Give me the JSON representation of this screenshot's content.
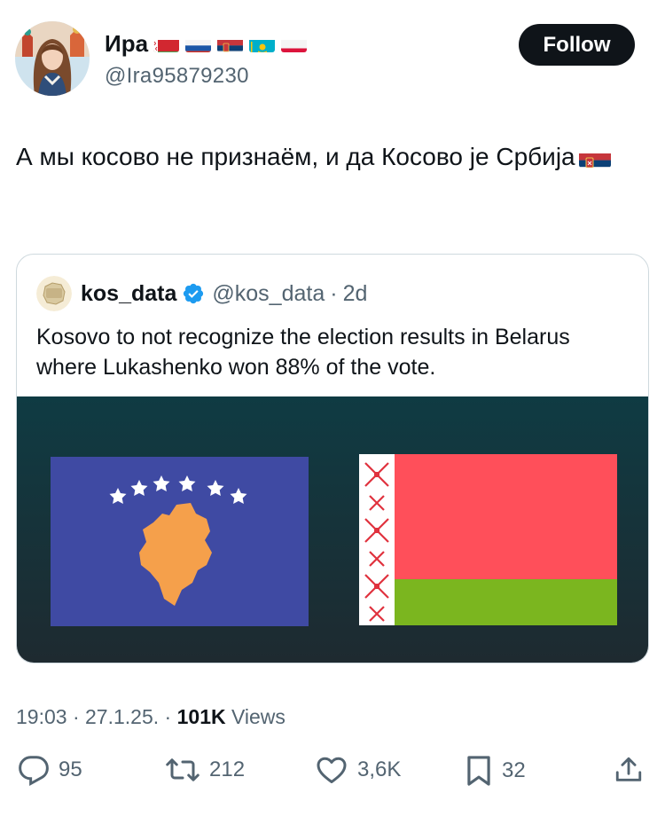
{
  "author": {
    "name": "Ира",
    "handle": "@Ira95879230",
    "flags": [
      "belarus-flag",
      "russia-flag",
      "serbia-flag",
      "kazakhstan-flag",
      "poland-flag"
    ]
  },
  "follow_label": "Follow",
  "tweet": {
    "text": "А мы косово не признаём, и да Косово је Србија",
    "flag": "serbia-flag"
  },
  "quote": {
    "name": "kos_data",
    "handle": "@kos_data",
    "separator": "·",
    "time": "2d",
    "text": "Kosovo to not recognize the election results in Belarus where Lukashenko won 88% of the vote.",
    "media": [
      "kosovo-flag",
      "belarus-flag"
    ]
  },
  "meta": {
    "time": "19:03",
    "sep1": " · ",
    "date": "27.1.25.",
    "sep2": " · ",
    "views_count": "101K",
    "views_label": " Views"
  },
  "actions": {
    "replies": "95",
    "reposts": "212",
    "likes": "3,6K",
    "bookmarks": "32"
  },
  "colors": {
    "text": "#0f1419",
    "secondary": "#536471",
    "verified": "#1d9bf0",
    "media_bg": "#14363e"
  }
}
